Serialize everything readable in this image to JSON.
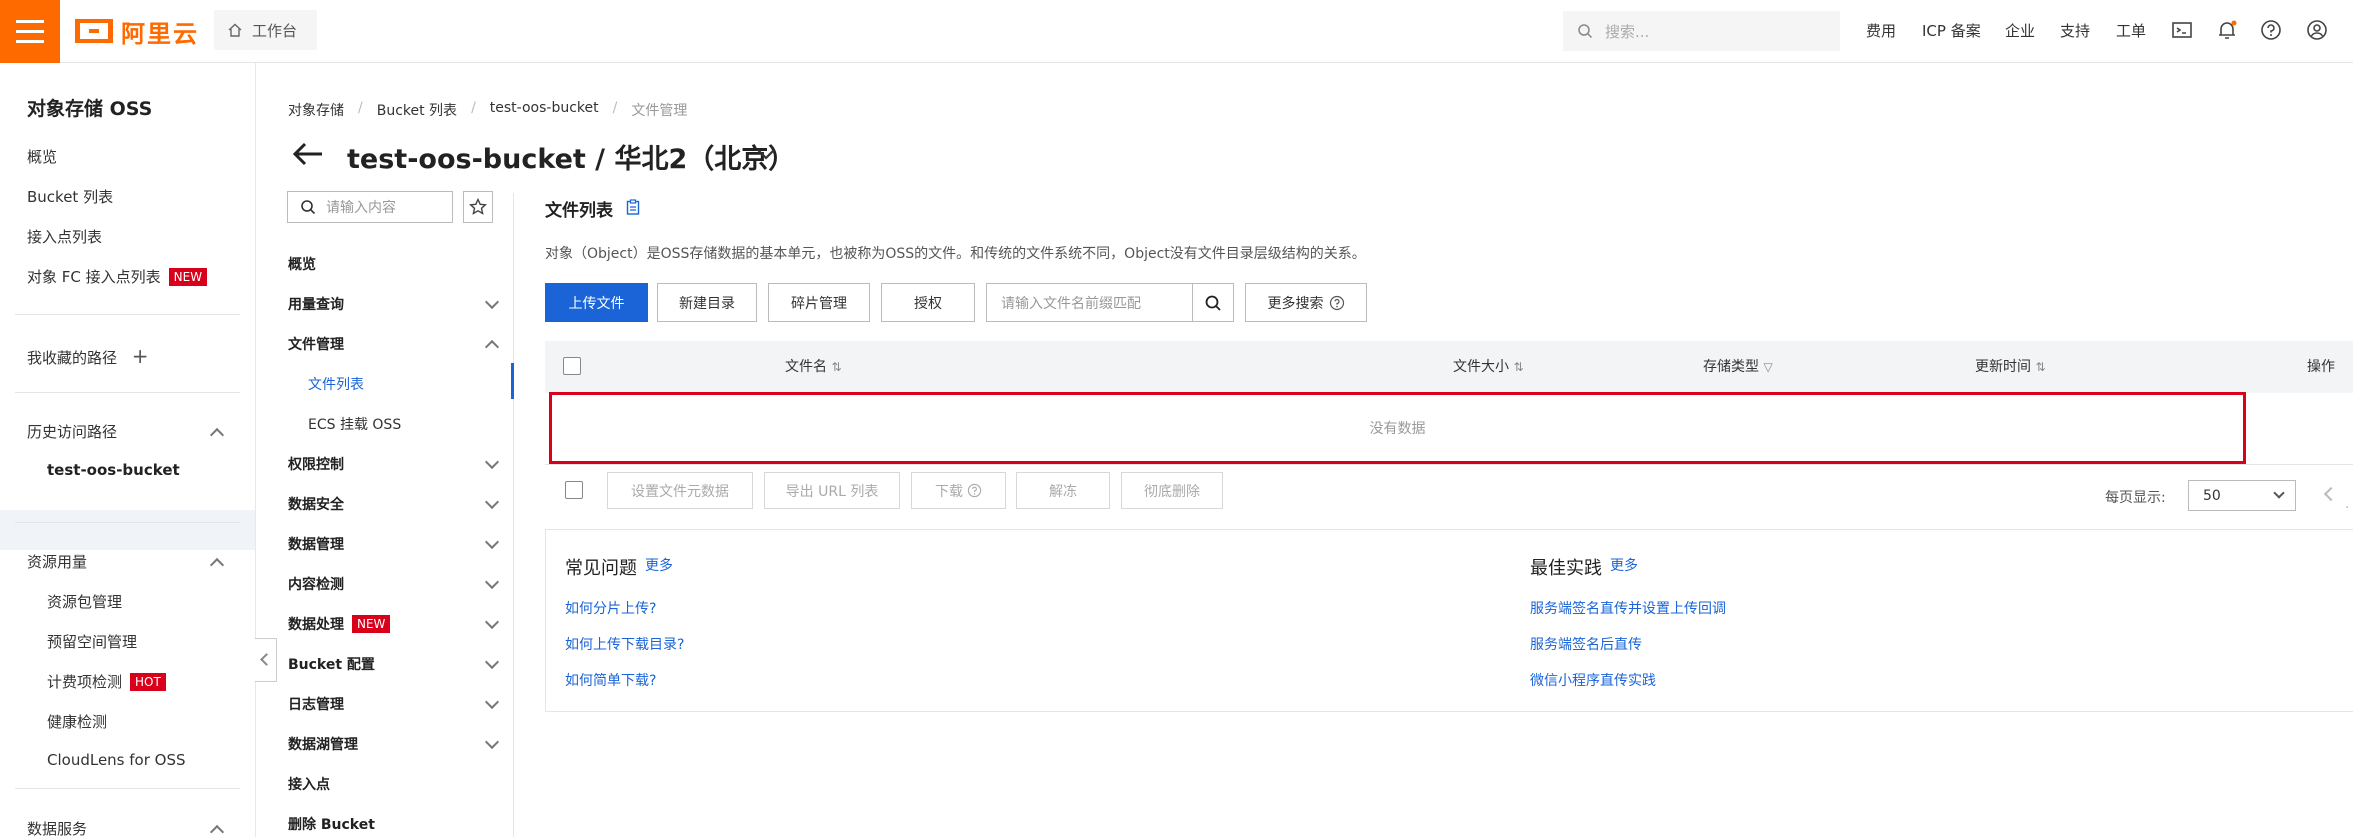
{
  "topbar": {
    "brand": "阿里云",
    "workbench": "工作台",
    "search_placeholder": "搜索...",
    "links": [
      "费用",
      "ICP 备案",
      "企业",
      "支持",
      "工单"
    ],
    "icons": [
      "terminal-icon",
      "bell-icon",
      "help-icon",
      "user-icon"
    ],
    "accent": "#ff6a00"
  },
  "sidebar": {
    "title": "对象存储 OSS",
    "items": [
      "概览",
      "Bucket 列表",
      "接入点列表",
      "对象 FC 接入点列表"
    ],
    "new_badge": "NEW",
    "favorites": "我收藏的路径",
    "history": "历史访问路径",
    "history_item": "test-oos-bucket",
    "resource_usage": "资源用量",
    "resource_items": [
      "资源包管理",
      "预留空间管理",
      "计费项检测",
      "健康检测",
      "CloudLens for OSS"
    ],
    "hot_badge": "HOT",
    "data_service": "数据服务"
  },
  "breadcrumb": [
    "对象存储",
    "Bucket 列表",
    "test-oos-bucket",
    "文件管理"
  ],
  "page_title": "test-oos-bucket / 华北2（北京）",
  "subnav": {
    "search_placeholder": "请输入内容",
    "items": {
      "overview": "概览",
      "usage": "用量查询",
      "file_mgmt": "文件管理",
      "file_list": "文件列表",
      "ecs_mount": "ECS 挂载 OSS",
      "permission": "权限控制",
      "security": "数据安全",
      "data_mgmt": "数据管理",
      "content_check": "内容检测",
      "data_process": "数据处理",
      "bucket_config": "Bucket 配置",
      "log_mgmt": "日志管理",
      "lake_mgmt": "数据湖管理",
      "access_point": "接入点",
      "delete_bucket": "删除 Bucket"
    },
    "new_badge": "NEW"
  },
  "main": {
    "title": "文件列表",
    "description": "对象（Object）是OSS存储数据的基本单元，也被称为OSS的文件。和传统的文件系统不同，Object没有文件目录层级结构的关系。",
    "buttons": {
      "upload": "上传文件",
      "new_dir": "新建目录",
      "fragments": "碎片管理",
      "authorize": "授权",
      "more_search": "更多搜索"
    },
    "file_search_placeholder": "请输入文件名前缀匹配",
    "columns": [
      "文件名",
      "文件大小",
      "存储类型",
      "更新时间",
      "操作"
    ],
    "empty_text": "没有数据",
    "bulk_actions": [
      "设置文件元数据",
      "导出 URL 列表",
      "下载",
      "解冻",
      "彻底删除"
    ],
    "per_page_label": "每页显示:",
    "per_page_value": "50"
  },
  "faq": {
    "title": "常见问题",
    "more": "更多",
    "links": [
      "如何分片上传?",
      "如何上传下载目录?",
      "如何简单下载?"
    ]
  },
  "best_practice": {
    "title": "最佳实践",
    "more": "更多",
    "links": [
      "服务端签名直传并设置上传回调",
      "服务端签名后直传",
      "微信小程序直传实践"
    ]
  }
}
